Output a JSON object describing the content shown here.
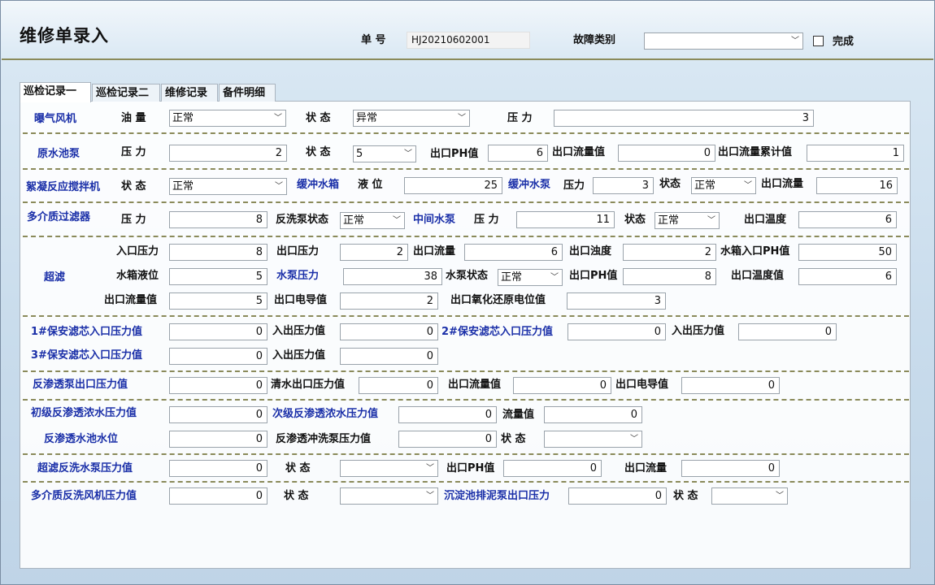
{
  "header": {
    "title": "维修单录入",
    "order_no_label": "单 号",
    "order_no_value": "HJ20210602001",
    "fault_type_label": "故障类别",
    "fault_type_value": "",
    "complete_label": "完成"
  },
  "tabs": [
    "巡检记录一",
    "巡检记录二",
    "维修记录",
    "备件明细"
  ],
  "aeration": {
    "title": "曝气风机",
    "oil_label": "油 量",
    "oil_value": "正常",
    "state_label": "状 态",
    "state_value": "异常",
    "pressure_label": "压 力",
    "pressure_value": "3"
  },
  "raw_pump": {
    "title": "原水池泵",
    "pressure_label": "压 力",
    "pressure_value": "2",
    "state_label": "状 态",
    "state_value": "5",
    "ph_label": "出口PH值",
    "ph_value": "6",
    "flow_label": "出口流量值",
    "flow_value": "0",
    "flow_total_label": "出口流量累计值",
    "flow_total_value": "1"
  },
  "flocculation": {
    "title": "絮凝反应搅拌机",
    "state_label": "状 态",
    "state_value": "正常",
    "buffer_tank": "缓冲水箱",
    "level_label": "液 位",
    "level_value": "25",
    "buffer_pump": "缓冲水泵",
    "pressure_label": "压力",
    "pressure_value": "3",
    "pump_state_label": "状态",
    "pump_state_value": "正常",
    "flow_label": "出口流量",
    "flow_value": "16"
  },
  "multimedia": {
    "title": "多介质过滤器",
    "pressure_label": "压 力",
    "pressure_value": "8",
    "backwash_label": "反洗泵状态",
    "backwash_value": "正常",
    "mid_pump": "中间水泵",
    "mid_pressure_label": "压 力",
    "mid_pressure_value": "11",
    "mid_state_label": "状态",
    "mid_state_value": "正常",
    "temp_label": "出口温度",
    "temp_value": "6"
  },
  "ultrafilter": {
    "title": "超滤",
    "in_pressure_label": "入口压力",
    "in_pressure_value": "8",
    "out_pressure_label": "出口压力",
    "out_pressure_value": "2",
    "out_flow_label": "出口流量",
    "out_flow_value": "6",
    "turbidity_label": "出口浊度",
    "turbidity_value": "2",
    "tank_ph_label": "水箱入口PH值",
    "tank_ph_value": "50",
    "tank_level_label": "水箱液位",
    "tank_level_value": "5",
    "pump_pressure_label": "水泵压力",
    "pump_pressure_value": "38",
    "pump_state_label": "水泵状态",
    "pump_state_value": "正常",
    "out_ph_label": "出口PH值",
    "out_ph_value": "8",
    "out_temp_label": "出口温度值",
    "out_temp_value": "6",
    "out_flow_val_label": "出口流量值",
    "out_flow_val_value": "5",
    "conductivity_label": "出口电导值",
    "conductivity_value": "2",
    "orp_label": "出口氧化还原电位值",
    "orp_value": "3"
  },
  "cartridge": {
    "f1_label": "1#保安滤芯入口压力值",
    "f1_value": "0",
    "f1_out_label": "入出压力值",
    "f1_out_value": "0",
    "f2_label": "2#保安滤芯入口压力值",
    "f2_value": "0",
    "f2_out_label": "入出压力值",
    "f2_out_value": "0",
    "f3_label": "3#保安滤芯入口压力值",
    "f3_value": "0",
    "f3_out_label": "入出压力值",
    "f3_out_value": "0"
  },
  "ro_pump": {
    "title": "反渗透泵出口压力值",
    "title_value": "0",
    "clear_label": "清水出口压力值",
    "clear_value": "0",
    "flow_label": "出口流量值",
    "flow_value": "0",
    "cond_label": "出口电导值",
    "cond_value": "0"
  },
  "ro_stage": {
    "first_label": "初级反渗透浓水压力值",
    "first_value": "0",
    "second_label": "次级反渗透浓水压力值",
    "second_value": "0",
    "flow_label": "流量值",
    "flow_value": "0",
    "tank_label": "反渗透水池水位",
    "tank_value": "0",
    "flush_label": "反渗透冲洗泵压力值",
    "flush_value": "0",
    "state_label": "状 态",
    "state_value": ""
  },
  "uf_backwash": {
    "title": "超滤反洗水泵压力值",
    "title_value": "0",
    "state_label": "状 态",
    "state_value": "",
    "ph_label": "出口PH值",
    "ph_value": "0",
    "flow_label": "出口流量",
    "flow_value": "0"
  },
  "mm_backwash": {
    "title": "多介质反洗风机压力值",
    "title_value": "0",
    "state_label": "状 态",
    "state_value": "",
    "sludge_label": "沉淀池排泥泵出口压力",
    "sludge_value": "0",
    "sludge_state_label": "状 态",
    "sludge_state_value": ""
  }
}
